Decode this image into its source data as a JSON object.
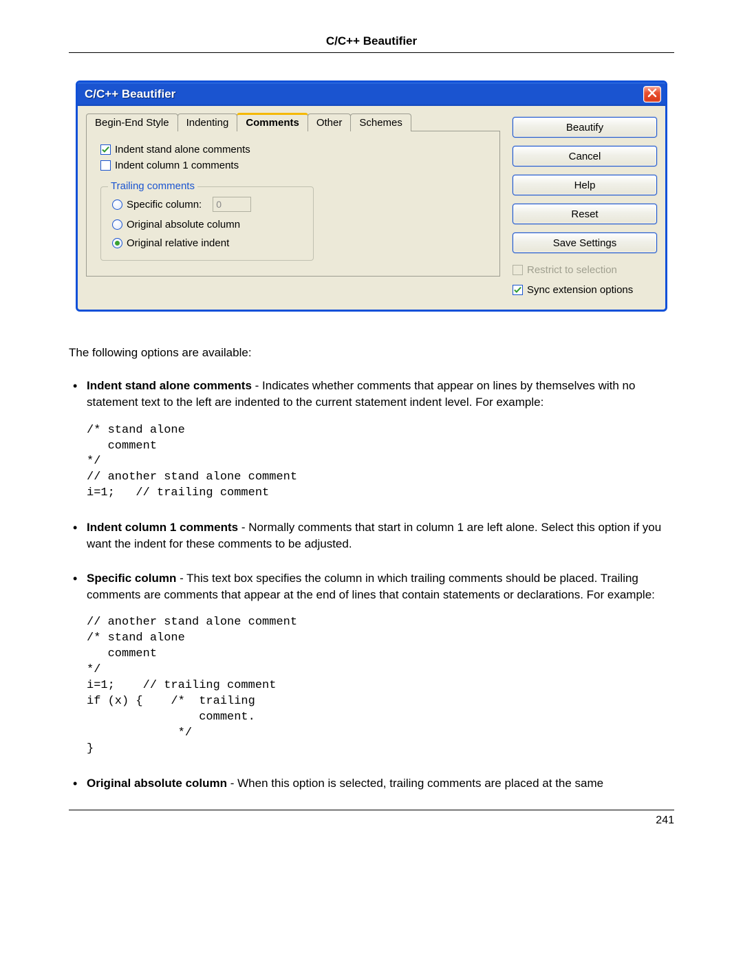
{
  "header": {
    "title": "C/C++ Beautifier"
  },
  "dialog": {
    "title": "C/C++ Beautifier",
    "tabs": {
      "t0": "Begin-End Style",
      "t1": "Indenting",
      "t2": "Comments",
      "t3": "Other",
      "t4": "Schemes"
    },
    "checks": {
      "standalone": "Indent stand alone comments",
      "col1": "Indent column 1 comments"
    },
    "trailing": {
      "legend": "Trailing comments",
      "specific": "Specific column:",
      "specific_value": "0",
      "abs": "Original absolute column",
      "rel": "Original relative indent"
    },
    "buttons": {
      "beautify": "Beautify",
      "cancel": "Cancel",
      "help": "Help",
      "reset": "Reset",
      "save": "Save Settings"
    },
    "bottom": {
      "restrict": "Restrict to selection",
      "sync": "Sync extension options"
    }
  },
  "doc": {
    "intro": "The following options are available:",
    "item1": {
      "bold": "Indent stand alone comments",
      "rest": " - Indicates whether comments that appear on lines by themselves with no statement text to the left are indented to the current statement indent level. For example:",
      "code": "/* stand alone\n   comment\n*/\n// another stand alone comment\ni=1;   // trailing comment"
    },
    "item2": {
      "bold": "Indent column 1 comments",
      "rest": " - Normally comments that start in column 1 are left alone. Select this option if you want the indent for these comments to be adjusted."
    },
    "item3": {
      "bold": "Specific column",
      "rest": " - This text box specifies the column in which trailing comments should be placed. Trailing comments are comments that appear at the end of lines that contain statements or declarations. For example:",
      "code": "// another stand alone comment\n/* stand alone\n   comment\n*/\ni=1;    // trailing comment\nif (x) {    /*  trailing\n                comment.\n             */\n}"
    },
    "item4": {
      "bold": "Original absolute column",
      "rest": " - When this option is selected, trailing comments are placed at the same"
    }
  },
  "footer": {
    "page": "241"
  }
}
